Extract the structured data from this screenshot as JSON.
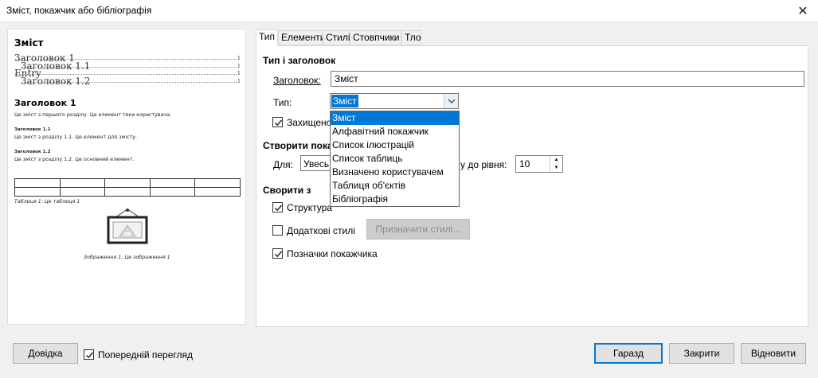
{
  "window": {
    "title": "Зміст, покажчик або бібліографія",
    "close_glyph": "✕"
  },
  "preview": {
    "title": "Зміст",
    "toc": [
      {
        "label": "Заголовок 1",
        "page": "1",
        "level": 1
      },
      {
        "label": "Заголовок 1.1",
        "page": "1",
        "level": 2
      },
      {
        "label": "Entry",
        "page": "1",
        "level": 1
      },
      {
        "label": "Заголовок 1.2",
        "page": "1",
        "level": 2
      }
    ],
    "heading1": "Заголовок 1",
    "text1": "Це зміст з першого розділу. Це елемент теки користувача.",
    "heading11": "Заголовок 1.1",
    "text11": "Це зміст з розділу 1.1. Це елемент для змісту.",
    "heading12": "Заголовок 1.2",
    "text12": "Це зміст з розділу 1.2. Це основний елемент.",
    "table_caption": "Таблиця 1: Це таблиця 1",
    "image_caption": "Зображення 1: Це зображення 1"
  },
  "tabs": [
    {
      "label": "Тип",
      "active": true
    },
    {
      "label": "Елементи",
      "active": false
    },
    {
      "label": "Стилі",
      "active": false
    },
    {
      "label": "Стовпчики",
      "active": false
    },
    {
      "label": "Тло",
      "active": false
    }
  ],
  "type_section": {
    "heading": "Тип і заголовок",
    "title_label": "Заголовок:",
    "title_value": "Зміст",
    "type_label": "Тип:",
    "type_value": "Зміст",
    "type_options": [
      "Зміст",
      "Алфавітний покажчик",
      "Список ілюстрацій",
      "Список таблиць",
      "Визначено користувачем",
      "Таблиця об'єктів",
      "Бібліографія"
    ],
    "protected_label": "Захищено"
  },
  "create_index": {
    "heading": "Створити пока",
    "for_label": "Для:",
    "for_value": "Увесь",
    "level_label": "у до рівня:",
    "level_value": "10"
  },
  "create_from": {
    "heading": "Сворити з",
    "outline_label": "Структура",
    "outline_checked": true,
    "additional_styles_label": "Додаткові стилі",
    "additional_styles_checked": false,
    "assign_styles_label": "Призначити стилі...",
    "index_marks_label": "Позначки покажчика",
    "index_marks_checked": true
  },
  "footer": {
    "help_label": "Довідка",
    "preview_label": "Попередній перегляд",
    "preview_checked": true,
    "ok_label": "Гаразд",
    "close_label": "Закрити",
    "reset_label": "Відновити"
  }
}
